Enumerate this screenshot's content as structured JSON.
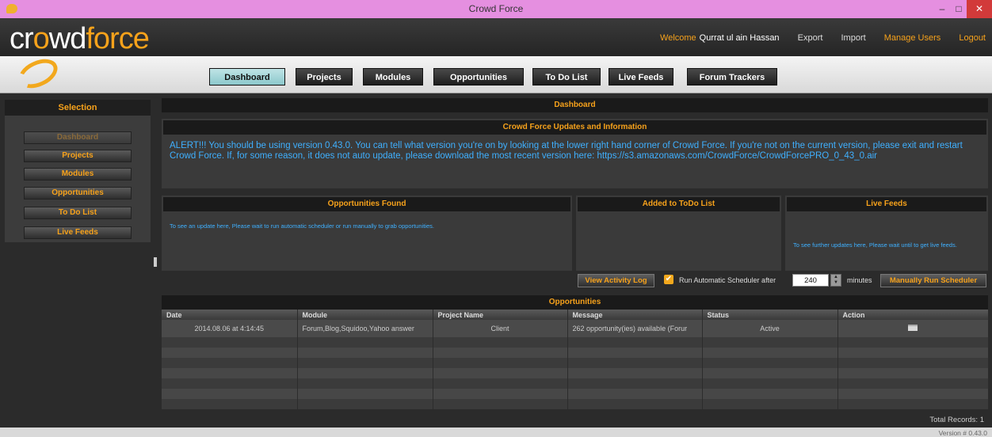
{
  "window": {
    "title": "Crowd Force"
  },
  "header": {
    "logo": {
      "part1": "cr",
      "part2": "o",
      "part3": "wd",
      "part4": "force"
    },
    "welcome_label": "Welcome",
    "user_name": "Qurrat ul ain Hassan",
    "export": "Export",
    "import": "Import",
    "manage_users": "Manage Users",
    "logout": "Logout"
  },
  "nav": {
    "tabs": [
      {
        "label": "Dashboard",
        "active": true
      },
      {
        "label": "Projects"
      },
      {
        "label": "Modules"
      },
      {
        "label": "Opportunities"
      },
      {
        "label": "To Do List"
      },
      {
        "label": "Live Feeds"
      },
      {
        "label": "Forum Trackers"
      }
    ]
  },
  "sidebar": {
    "title": "Selection",
    "items": [
      {
        "label": "Dashboard",
        "active": true
      },
      {
        "label": "Projects"
      },
      {
        "label": "Modules"
      },
      {
        "label": "Opportunities"
      },
      {
        "label": "To Do List"
      },
      {
        "label": "Live Feeds"
      }
    ]
  },
  "dashboard": {
    "title": "Dashboard",
    "updates_title": "Crowd Force Updates and Information",
    "alert_text": "ALERT!!! You should be using version 0.43.0. You can tell what version you're on by looking at the lower right hand corner of Crowd Force. If you're not on the current version, please exit and restart Crowd Force. If, for some reason, it does not auto update, please download the most recent version here: https://s3.amazonaws.com/CrowdForce/CrowdForcePRO_0_43_0.air",
    "opps_found_title": "Opportunities Found",
    "opps_found_text": "To see an update here, Please wait to run automatic scheduler or run manually to grab opportunities.",
    "todo_title": "Added to ToDo List",
    "livefeeds_title": "Live Feeds",
    "livefeeds_text": "To see further updates here, Please wait until to get live feeds."
  },
  "scheduler": {
    "view_log": "View Activity Log",
    "run_auto_label": "Run Automatic Scheduler after",
    "run_auto_checked": true,
    "minutes_value": "240",
    "minutes_label": "minutes",
    "manual_run": "Manually Run Scheduler"
  },
  "opportunities": {
    "title": "Opportunities",
    "columns": [
      "Date",
      "Module",
      "Project Name",
      "Message",
      "Status",
      "Action"
    ],
    "rows": [
      {
        "date": "2014.08.06 at 4:14:45",
        "module": "Forum,Blog,Squidoo,Yahoo answer",
        "project": "Client",
        "message": "262 opportunity(ies) available (Forur",
        "status": "Active",
        "action_icon": "calendar-icon"
      }
    ],
    "total_records": "Total Records: 1"
  },
  "footer": {
    "version": "Version # 0.43.0"
  }
}
